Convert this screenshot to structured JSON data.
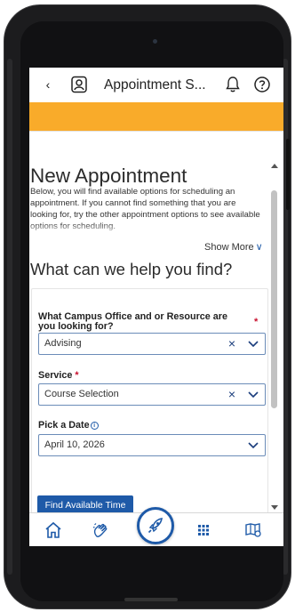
{
  "header": {
    "back_label": "‹",
    "title": "Appointment S...",
    "back_icon": "chevron-left-icon",
    "appointment_icon": "appointment-badge-icon",
    "bell_icon": "bell-icon",
    "help_icon": "help-circle-icon"
  },
  "page": {
    "title": "New Appointment",
    "description": "Below, you will find available options for scheduling an appointment. If you cannot find something that you are looking for, try the other appointment options to see available options for scheduling.",
    "show_more_label": "Show More",
    "section_title": "What can we help you find?"
  },
  "form": {
    "office": {
      "label": "What Campus Office and or Resource are you looking for?",
      "required_mark": "*",
      "value": "Advising"
    },
    "service": {
      "label": "Service",
      "required_mark": "*",
      "value": "Course Selection"
    },
    "date": {
      "label": "Pick a Date",
      "info_mark": "i",
      "value": "April 10, 2026"
    },
    "submit_label": "Find Available Time"
  },
  "bottom_nav": {
    "items": [
      "home-icon",
      "hand-wave-icon",
      "rocket-icon",
      "grid-icon",
      "map-book-icon"
    ]
  },
  "colors": {
    "accent": "#1e5aa8",
    "banner": "#f9ab2a",
    "required": "#c8102e"
  }
}
